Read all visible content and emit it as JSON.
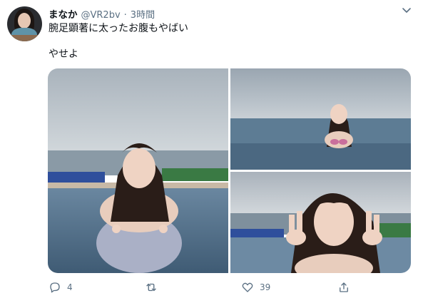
{
  "tweet": {
    "display_name": "まなか",
    "handle": "@VR2bv",
    "separator": "·",
    "time": "3時間",
    "text_line1": "腕足顕著に太ったお腹もやばい",
    "text_line2": "やせよ"
  },
  "media": [
    {
      "icon": "photo-pool-woman"
    },
    {
      "icon": "photo-infinity-pool"
    },
    {
      "icon": "photo-peace-sign"
    }
  ],
  "actions": {
    "reply": {
      "icon": "reply-icon",
      "count": "4"
    },
    "retweet": {
      "icon": "retweet-icon",
      "count": ""
    },
    "like": {
      "icon": "heart-icon",
      "count": "39"
    },
    "share": {
      "icon": "share-icon",
      "count": ""
    }
  },
  "colors": {
    "text": "#0f1419",
    "secondary": "#5b7083",
    "sky": "#b9c3cc",
    "water": "#5d7a93"
  }
}
